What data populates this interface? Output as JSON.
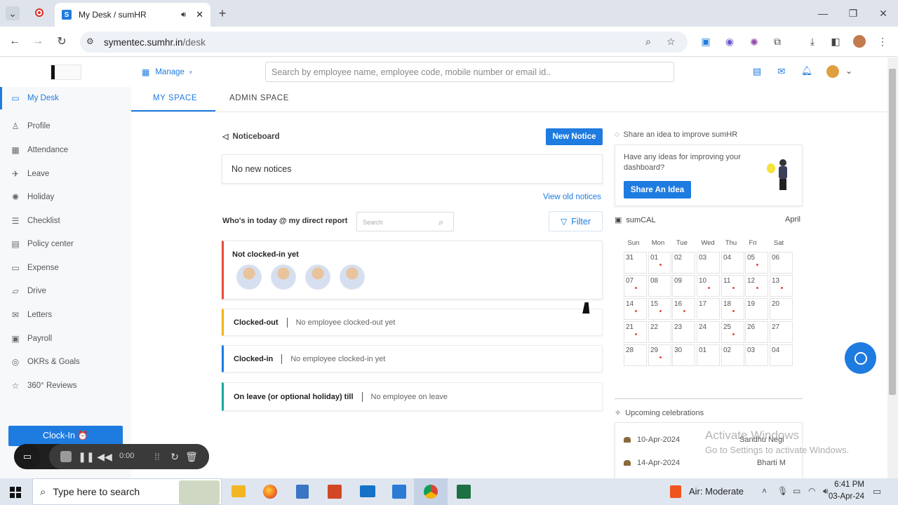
{
  "browser": {
    "tab_title": "My Desk / sumHR",
    "url_host": "symentec.sumhr.in",
    "url_path": "/desk"
  },
  "header": {
    "manage_label": "Manage",
    "search_placeholder": "Search by employee name, employee code, mobile number or email id.."
  },
  "sidebar": {
    "items": [
      {
        "label": "My Desk",
        "icon": "monitor-icon"
      },
      {
        "label": "Profile",
        "icon": "user-icon"
      },
      {
        "label": "Attendance",
        "icon": "calendar-icon"
      },
      {
        "label": "Leave",
        "icon": "plane-icon"
      },
      {
        "label": "Holiday",
        "icon": "sun-icon"
      },
      {
        "label": "Checklist",
        "icon": "checklist-icon"
      },
      {
        "label": "Policy center",
        "icon": "book-icon"
      },
      {
        "label": "Expense",
        "icon": "card-icon"
      },
      {
        "label": "Drive",
        "icon": "folder-icon"
      },
      {
        "label": "Letters",
        "icon": "mail-icon"
      },
      {
        "label": "Payroll",
        "icon": "receipt-icon"
      },
      {
        "label": "OKRs & Goals",
        "icon": "target-icon"
      },
      {
        "label": "360° Reviews",
        "icon": "star-icon"
      }
    ],
    "clock_in_label": "Clock-In ⏰"
  },
  "tabs": {
    "my_space": "MY SPACE",
    "admin_space": "ADMIN SPACE"
  },
  "noticeboard": {
    "title": "Noticeboard",
    "new_notice": "New Notice",
    "empty": "No new notices",
    "view_old": "View old notices"
  },
  "whos_in": {
    "title": "Who's in today @ my direct report",
    "search_placeholder": "Search",
    "filter_label": "Filter",
    "not_clocked_in": "Not clocked-in yet",
    "clocked_out": {
      "label": "Clocked-out",
      "value": "No employee clocked-out yet",
      "color": "#f2b21b"
    },
    "clocked_in": {
      "label": "Clocked-in",
      "value": "No employee clocked-in yet",
      "color": "#1e7be0"
    },
    "on_leave": {
      "label": "On leave (or optional holiday) till",
      "value": "No employee on leave",
      "color": "#18a999"
    },
    "not_clocked_color": "#e74c3c"
  },
  "idea": {
    "title": "Share an idea to improve sumHR",
    "text": "Have any ideas for improving your dashboard?",
    "button": "Share An Idea"
  },
  "calendar": {
    "title": "sumCAL",
    "month": "April",
    "days": [
      "Sun",
      "Mon",
      "Tue",
      "Wed",
      "Thu",
      "Fri",
      "Sat"
    ],
    "weeks": [
      [
        "31",
        "01",
        "02",
        "03",
        "04",
        "05",
        "06"
      ],
      [
        "07",
        "08",
        "09",
        "10",
        "11",
        "12",
        "13"
      ],
      [
        "14",
        "15",
        "16",
        "17",
        "18",
        "19",
        "20"
      ],
      [
        "21",
        "22",
        "23",
        "24",
        "25",
        "26",
        "27"
      ],
      [
        "28",
        "29",
        "30",
        "01",
        "02",
        "03",
        "04"
      ]
    ],
    "dots": [
      "01",
      "05",
      "07",
      "10",
      "11",
      "12",
      "13",
      "14",
      "15",
      "16",
      "18",
      "21",
      "25",
      "29"
    ]
  },
  "celebrations": {
    "title": "Upcoming celebrations",
    "items": [
      {
        "date": "10-Apr-2024",
        "name": "Sandhu Negi"
      },
      {
        "date": "14-Apr-2024",
        "name": "Bharti M"
      }
    ]
  },
  "watermark": {
    "line1": "Activate Windows",
    "line2": "Go to Settings to activate Windows."
  },
  "recorder": {
    "time": "0:00"
  },
  "taskbar": {
    "search_placeholder": "Type here to search",
    "weather": "Air: Moderate",
    "time": "6:41 PM",
    "date": "03-Apr-24"
  }
}
